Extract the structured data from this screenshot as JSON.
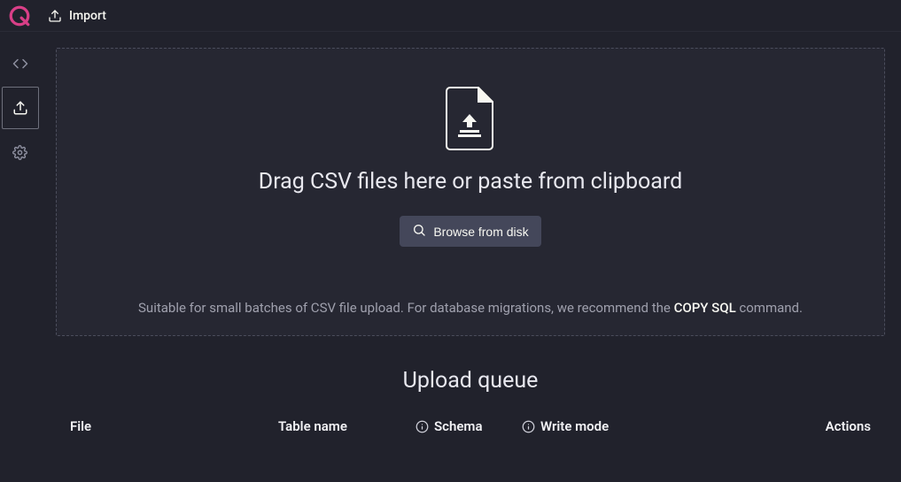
{
  "header": {
    "tab_label": "Import"
  },
  "dropzone": {
    "title": "Drag CSV files here or paste from clipboard",
    "browse_label": "Browse from disk",
    "footer_pre": "Suitable for small batches of CSV file upload. For database migrations, we recommend the ",
    "footer_link": "COPY SQL",
    "footer_post": " command."
  },
  "queue": {
    "title": "Upload queue",
    "columns": {
      "file": "File",
      "table": "Table name",
      "schema": "Schema",
      "write": "Write mode",
      "actions": "Actions"
    }
  }
}
